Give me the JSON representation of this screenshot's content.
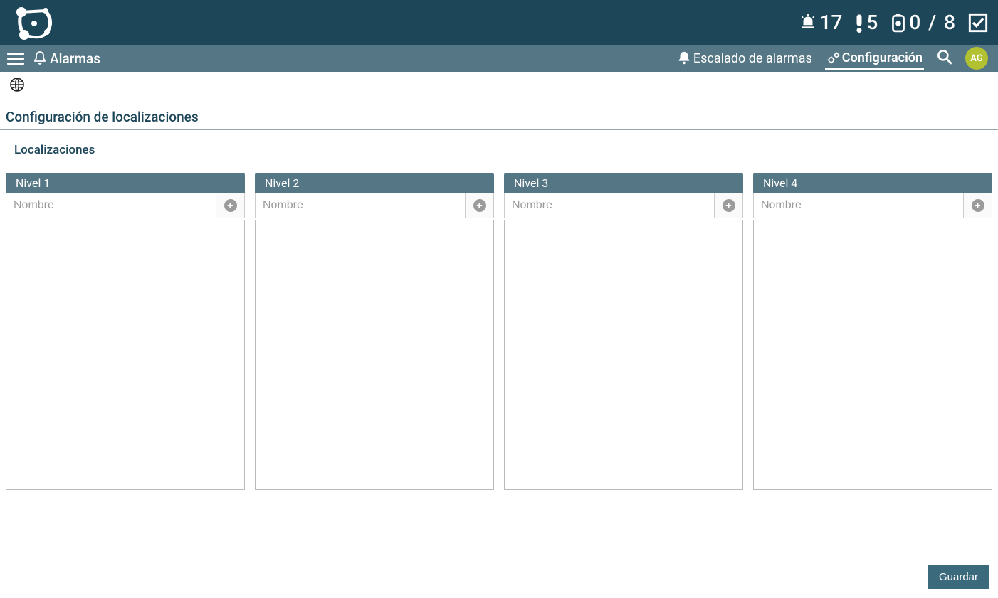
{
  "header": {
    "status": {
      "alarm_count": "17",
      "alert_count": "5",
      "battery_left": "0",
      "battery_right": "8"
    }
  },
  "subheader": {
    "title": "Alarmas",
    "tabs": {
      "escalation": "Escalado de alarmas",
      "configuration": "Configuración"
    },
    "avatar": "AG"
  },
  "page": {
    "title": "Configuración de localizaciones",
    "subsection": "Localizaciones"
  },
  "levels": [
    {
      "label": "Nivel 1",
      "placeholder": "Nombre"
    },
    {
      "label": "Nivel 2",
      "placeholder": "Nombre"
    },
    {
      "label": "Nivel 3",
      "placeholder": "Nombre"
    },
    {
      "label": "Nivel 4",
      "placeholder": "Nombre"
    }
  ],
  "actions": {
    "save": "Guardar"
  }
}
